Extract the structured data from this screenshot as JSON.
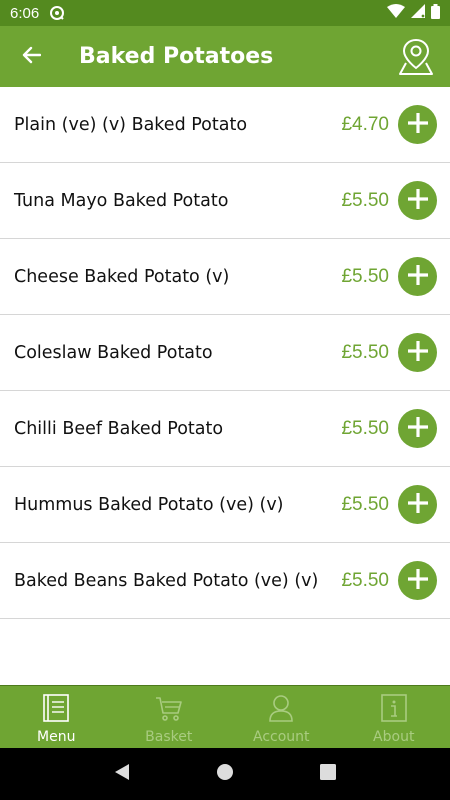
{
  "status_bar": {
    "time": "6:06"
  },
  "header": {
    "title": "Baked Potatoes"
  },
  "menu_items": [
    {
      "name": "Plain (ve) (v) Baked Potato",
      "price": "£4.70"
    },
    {
      "name": "Tuna Mayo Baked Potato",
      "price": "£5.50"
    },
    {
      "name": "Cheese Baked Potato (v)",
      "price": "£5.50"
    },
    {
      "name": "Coleslaw Baked Potato",
      "price": "£5.50"
    },
    {
      "name": "Chilli Beef Baked Potato",
      "price": "£5.50"
    },
    {
      "name": "Hummus Baked Potato (ve) (v)",
      "price": "£5.50"
    },
    {
      "name": "Baked Beans Baked Potato (ve) (v)",
      "price": "£5.50"
    }
  ],
  "bottom_nav": {
    "items": [
      {
        "label": "Menu",
        "icon": "book-icon",
        "active": true
      },
      {
        "label": "Basket",
        "icon": "cart-icon",
        "active": false
      },
      {
        "label": "Account",
        "icon": "person-icon",
        "active": false
      },
      {
        "label": "About",
        "icon": "info-icon",
        "active": false
      }
    ]
  },
  "colors": {
    "brand_green": "#6fa533",
    "status_bar_green": "#548a1f",
    "inactive_nav": "#a9cc80",
    "price_text": "#6fa533"
  }
}
